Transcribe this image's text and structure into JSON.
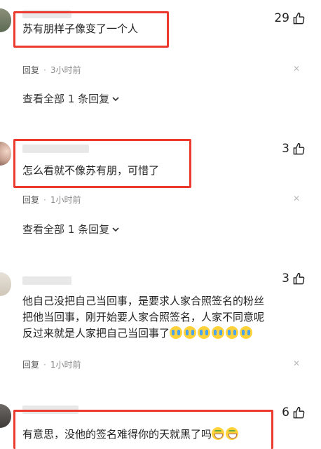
{
  "comments": [
    {
      "likes": "29",
      "text": "苏有朋样子像变了一个人",
      "reply": "回复",
      "time": "3小时前",
      "view_replies": "查看全部 1 条回复"
    },
    {
      "likes": "3",
      "text": "怎么看就不像苏有朋，可惜了",
      "reply": "回复",
      "time": "1小时前",
      "view_replies": "查看全部 1 条回复"
    },
    {
      "likes": "3",
      "lines": [
        "他自己没把自己当回事，是要求人家合照签名的粉丝",
        "把他当回事，刚开始要人家合照签名，人家不同意呢",
        "反过来就是人家把自己当回事了"
      ],
      "reply": "回复",
      "time": "1小时前"
    },
    {
      "likes": "6",
      "text": "有意思，没他的签名难得你的天就黑了吗"
    }
  ],
  "icons": {
    "like": "thumbs-up-icon",
    "close": "close-icon",
    "chevron": "chevron-down-icon"
  },
  "colors": {
    "highlight_box": "#ea3b2e"
  }
}
